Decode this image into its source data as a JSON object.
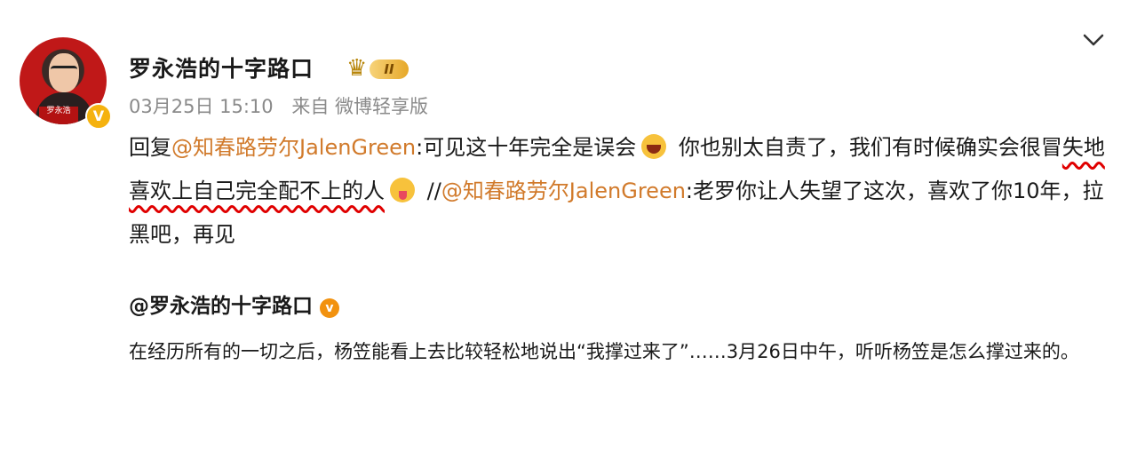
{
  "post": {
    "author_name": "罗永浩的十字路口",
    "vip_level": "II",
    "verify_mark": "V",
    "avatar_plate_text": "罗永浩",
    "date": "03月25日 15:10",
    "source": "来自 微博轻享版"
  },
  "content": {
    "reply_prefix": "回复",
    "mention_1": "@知春路劳尔JalenGreen",
    "text_1": ":可见这十年完全是误会",
    "text_2": " 你也别太自责了，我们有时候确实会很冒",
    "underlined": "失地喜欢上自己完全配不上的人",
    "emoji_1": "laugh-emoji",
    "emoji_2": "tongue-emoji",
    "separator": " //",
    "mention_2": "@知春路劳尔JalenGreen",
    "text_3": ":老罗你让人失望了这次，喜欢了你10年，拉黑吧，再见"
  },
  "quote": {
    "author": "@罗永浩的十字路口",
    "verify_mark": "v",
    "text": "在经历所有的一切之后，杨笠能看上去比较轻松地说出“我撑过来了”……3月26日中午，听听杨笠是怎么撑过来的。"
  },
  "colors": {
    "mention": "#d17a2b",
    "underline": "#e00000",
    "meta": "#8a8a8a",
    "verify": "#f5b20f"
  }
}
